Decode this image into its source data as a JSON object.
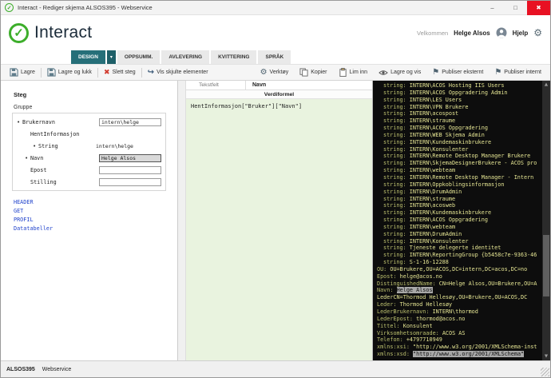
{
  "window": {
    "title": "Interact - Rediger skjema ALSOS395 - Webservice"
  },
  "header": {
    "logo_text": "Interact",
    "welcome": "Velkommen",
    "user_name": "Helge Alsos",
    "help_label": "Hjelp"
  },
  "tabs": [
    {
      "label": "DESIGN",
      "active": true
    },
    {
      "label": "OPPSUMM.",
      "active": false
    },
    {
      "label": "AVLEVERING",
      "active": false
    },
    {
      "label": "KVITTERING",
      "active": false
    },
    {
      "label": "SPRÅK",
      "active": false
    }
  ],
  "toolbar": {
    "left": [
      {
        "label": "Lagre",
        "icon": "save"
      },
      {
        "label": "Lagre og lukk",
        "icon": "save"
      },
      {
        "label": "Slett steg",
        "icon": "delete"
      },
      {
        "label": "Vis skjulte elementer",
        "icon": "show"
      }
    ],
    "right": [
      {
        "label": "Verktøy",
        "icon": "gear"
      },
      {
        "label": "Kopier",
        "icon": "copy"
      },
      {
        "label": "Lim inn",
        "icon": "paste"
      },
      {
        "label": "Lagre og vis",
        "icon": "eye"
      },
      {
        "label": "Publiser eksternt",
        "icon": "flag"
      },
      {
        "label": "Publiser internt",
        "icon": "flag"
      }
    ]
  },
  "left_panel": {
    "steg_label": "Steg",
    "gruppe_label": "Gruppe",
    "fields": [
      {
        "label": "Brukernavn",
        "bullet": true,
        "indent": 0,
        "control": "input",
        "value": "intern\\helge",
        "selected": false
      },
      {
        "label": "HentInformasjon",
        "bullet": false,
        "indent": 1,
        "control": "none",
        "value": "",
        "selected": false
      },
      {
        "label": "String",
        "bullet": true,
        "indent": 2,
        "control": "text",
        "value": "intern\\helge",
        "selected": false
      },
      {
        "label": "Navn",
        "bullet": true,
        "indent": 1,
        "control": "input",
        "value": "Helge Alsos",
        "selected": true
      },
      {
        "label": "Epost",
        "bullet": false,
        "indent": 1,
        "control": "input",
        "value": "",
        "selected": false
      },
      {
        "label": "Stilling",
        "bullet": false,
        "indent": 1,
        "control": "input",
        "value": "",
        "selected": false
      }
    ],
    "links": [
      "HEADER",
      "GET",
      "PROFIL",
      "Datatabeller"
    ]
  },
  "middle_panel": {
    "type_label": "Tekstfelt",
    "name_label": "Navn",
    "formula_header": "Verdiformel",
    "formula": "HentInformasjon[\"Bruker\"][\"Navn\"]"
  },
  "console": {
    "lines": [
      {
        "k": "string:",
        "v": "INTERN\\ACOS Hosting IIS Users",
        "ind": 1
      },
      {
        "k": "string:",
        "v": "INTERN\\ACOS Oppgradering Admin",
        "ind": 1
      },
      {
        "k": "string:",
        "v": "INTERN\\LES Users",
        "ind": 1
      },
      {
        "k": "string:",
        "v": "INTERN\\VPN Brukere",
        "ind": 1
      },
      {
        "k": "string:",
        "v": "INTERN\\acospost",
        "ind": 1
      },
      {
        "k": "string:",
        "v": "INTERN\\straume",
        "ind": 1
      },
      {
        "k": "string:",
        "v": "INTERN\\ACOS Oppgradering",
        "ind": 1
      },
      {
        "k": "string:",
        "v": "INTERN\\WEB Skjema Admin",
        "ind": 1
      },
      {
        "k": "string:",
        "v": "INTERN\\Kundemaskinbrukere",
        "ind": 1
      },
      {
        "k": "string:",
        "v": "INTERN\\Konsulenter",
        "ind": 1
      },
      {
        "k": "string:",
        "v": "INTERN\\Remote Desktop Manager Brukere",
        "ind": 1
      },
      {
        "k": "string:",
        "v": "INTERN\\SkjemaDesignerBrukere - ACOS pro",
        "ind": 1
      },
      {
        "k": "string:",
        "v": "INTERN\\webteam",
        "ind": 1
      },
      {
        "k": "string:",
        "v": "INTERN\\Remote Desktop Manager - Intern",
        "ind": 1
      },
      {
        "k": "string:",
        "v": "INTERN\\Oppkoblingsinformasjon",
        "ind": 1
      },
      {
        "k": "string:",
        "v": "INTERN\\DrumAdmin",
        "ind": 1
      },
      {
        "k": "string:",
        "v": "INTERN\\straume",
        "ind": 1
      },
      {
        "k": "string:",
        "v": "INTERN\\acosweb",
        "ind": 1
      },
      {
        "k": "string:",
        "v": "INTERN\\Kundemaskinbrukere",
        "ind": 1
      },
      {
        "k": "string:",
        "v": "INTERN\\ACOS Oppgradering",
        "ind": 1
      },
      {
        "k": "string:",
        "v": "INTERN\\webteam",
        "ind": 1
      },
      {
        "k": "string:",
        "v": "INTERN\\DrumAdmin",
        "ind": 1
      },
      {
        "k": "string:",
        "v": "INTERN\\Konsulenter",
        "ind": 1
      },
      {
        "k": "string:",
        "v": "Tjeneste delegerte identitet",
        "ind": 1
      },
      {
        "k": "string:",
        "v": "INTERN\\ReportingGroup {b5458c7e-9363-46",
        "ind": 1
      },
      {
        "k": "string:",
        "v": "S-1-16-12288",
        "ind": 1
      },
      {
        "k": "OU:",
        "v": "OU=Brukere,OU=ACOS,DC=intern,DC=acos,DC=no",
        "ind": 0
      },
      {
        "k": "Epost:",
        "v": "helge@acos.no",
        "ind": 0
      },
      {
        "k": "DistinguishedName:",
        "v": "CN=Helge Alsos,OU=Brukere,OU=A",
        "ind": 0
      },
      {
        "k": "Navn:",
        "v": "Helge Alsos",
        "ind": 0,
        "hl": true
      },
      {
        "k": "",
        "v": "LederCN=Thormod Hellesøy,OU=Brukere,OU=ACOS,DC",
        "ind": 0
      },
      {
        "k": "Leder:",
        "v": "Thormod Hellesøy",
        "ind": 0
      },
      {
        "k": "LederBrukernavn:",
        "v": "INTERN\\thormod",
        "ind": 0
      },
      {
        "k": "LederEpost:",
        "v": "thormod@acos.no",
        "ind": 0
      },
      {
        "k": "Tittel:",
        "v": "Konsulent",
        "ind": 0
      },
      {
        "k": "Virksomhetsomraade:",
        "v": "ACOS AS",
        "ind": 0
      },
      {
        "k": "Telefon:",
        "v": "+4797710949",
        "ind": 0
      },
      {
        "k": "xmlns:xsi:",
        "v": "\"http://www.w3.org/2001/XMLSchema-inst",
        "ind": 0
      },
      {
        "k": "xmlns:xsd:",
        "v": "\"http://www.w3.org/2001/XMLSchema\"",
        "ind": 0,
        "hl": true
      }
    ]
  },
  "statusbar": {
    "form_id": "ALSOS395",
    "mode": "Webservice"
  },
  "icons": {
    "check": "✓",
    "minimize": "–",
    "maximize": "□",
    "close": "✖",
    "gear": "⚙",
    "flag": "⚑",
    "delete": "✖",
    "show_hidden": "↪",
    "caret_down": "▾",
    "scroll_up": "▲",
    "scroll_down": "▼"
  },
  "colors": {
    "accent_teal": "#266f79",
    "logo_green": "#3dae2b",
    "console_bg": "#0d0d0d",
    "formula_bg": "#e9f3df"
  }
}
